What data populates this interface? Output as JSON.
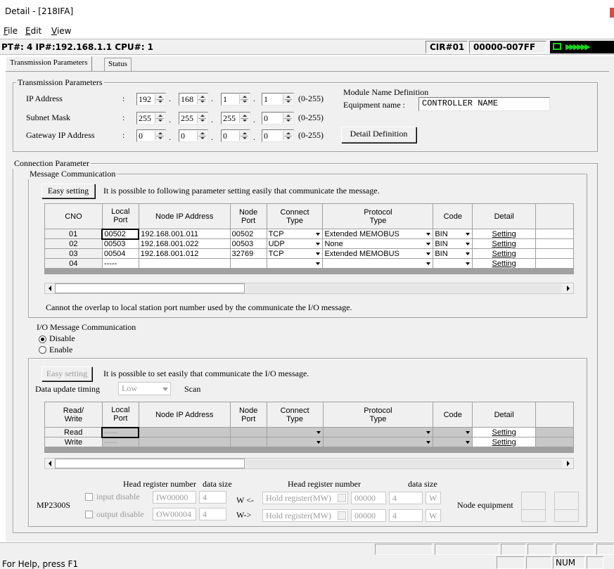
{
  "window": {
    "title": "Detail - [218IFA]"
  },
  "menu": {
    "file": "File",
    "file_key": "F",
    "file_rest": "ile",
    "edit_key": "E",
    "edit_rest": "dit",
    "view_key": "V",
    "view_rest": "iew"
  },
  "infobar": {
    "pt_info": "PT#: 4 IP#:192.168.1.1 CPU#: 1",
    "cir": "CIR#01",
    "range": "00000-007FF",
    "led_arrows": "▶▶▶▶▶▶"
  },
  "tabs": {
    "transmission": "Transmission Parameters",
    "status": "Status"
  },
  "transmission": {
    "group_label": "Transmission Parameters",
    "ip_label": "IP Address",
    "subnet_label": "Subnet Mask",
    "gateway_label": "Gateway IP Address",
    "colon": ":",
    "ip": [
      "192",
      "168",
      "1",
      "1"
    ],
    "subnet": [
      "255",
      "255",
      "255",
      "0"
    ],
    "gateway": [
      "0",
      "0",
      "0",
      "0"
    ],
    "range_hint": "(0-255)",
    "module_name_def": "Module Name Definition",
    "equipment_name_label": "Equipment name :",
    "equipment_name_value": "CONTROLLER NAME",
    "detail_definition_btn": "Detail Definition"
  },
  "connection": {
    "group_label": "Connection Parameter",
    "message_group_label": "Message Communication",
    "easy_setting": "Easy setting",
    "easy_hint": "It is possible to following parameter setting easily that communicate the  message.",
    "headers": {
      "cno": "CNO",
      "local_port_1": "Local",
      "local_port_2": "Port",
      "node_ip": "Node IP Address",
      "node_port_1": "Node",
      "node_port_2": "Port",
      "connect_type_1": "Connect",
      "connect_type_2": "Type",
      "protocol_type_1": "Protocol",
      "protocol_type_2": "Type",
      "code": "Code",
      "detail": "Detail"
    },
    "rows": [
      {
        "cno": "01",
        "local": "00502",
        "ip": "192.168.001.011",
        "nport": "00502",
        "ctype": "TCP",
        "proto": "Extended MEMOBUS",
        "code": "BIN",
        "detail": "Setting"
      },
      {
        "cno": "02",
        "local": "00503",
        "ip": "192.168.001.022",
        "nport": "00503",
        "ctype": "UDP",
        "proto": "None",
        "code": "BIN",
        "detail": "Setting"
      },
      {
        "cno": "03",
        "local": "00504",
        "ip": "192.168.001.012",
        "nport": "32769",
        "ctype": "TCP",
        "proto": "Extended MEMOBUS",
        "code": "BIN",
        "detail": "Setting"
      },
      {
        "cno": "04",
        "local": "-----",
        "ip": "",
        "nport": "",
        "ctype": "",
        "proto": "",
        "code": "",
        "detail": "Setting"
      }
    ],
    "overlap_note": "Cannot the overlap to local station port number used by the communicate the  I/O message.",
    "io_label": "I/O Message Communication",
    "io_disable": "Disable",
    "io_enable": "Enable",
    "io_easy_setting": "Easy setting",
    "io_easy_hint": "It is possible to set easily that communicate the I/O message.",
    "data_update_label": "Data update timing",
    "data_update_value": "Low",
    "scan_label": "Scan",
    "io_headers": {
      "rw_1": "Read/",
      "rw_2": "Write",
      "local_1": "Local",
      "local_2": "Port",
      "node_ip": "Node IP Address",
      "node_port_1": "Node",
      "node_port_2": "Port",
      "ctype_1": "Connect",
      "ctype_2": "Type",
      "proto_1": "Protocol",
      "proto_2": "Type",
      "code": "Code",
      "detail": "Detail"
    },
    "io_rows": [
      {
        "rw": "Read",
        "local": "-----",
        "detail": "Setting"
      },
      {
        "rw": "Write",
        "local": "-----",
        "detail": "Setting"
      }
    ],
    "head_reg_label": "Head register number",
    "data_size_label": "data size",
    "head_reg_label_2": "Head register number",
    "data_size_label_2": "data size",
    "device": "MP2300S",
    "input_disable": "input disable",
    "output_disable": "output disable",
    "in_reg": "IW00000",
    "in_size": "4",
    "out_reg": "OW00004",
    "out_size": "4",
    "w_in": "W <-",
    "w_out": "W->",
    "hold_reg_1": "Hold register(MW)",
    "hold_reg_2": "Hold register(MW)",
    "hold_addr_1": "00000",
    "hold_addr_2": "00000",
    "hold_size_1": "4",
    "hold_size_2": "4",
    "unit_w_1": "W",
    "unit_w_2": "W",
    "node_equipment": "Node equipment"
  },
  "statusbar": {
    "help": "For Help, press F1",
    "num": "NUM"
  }
}
